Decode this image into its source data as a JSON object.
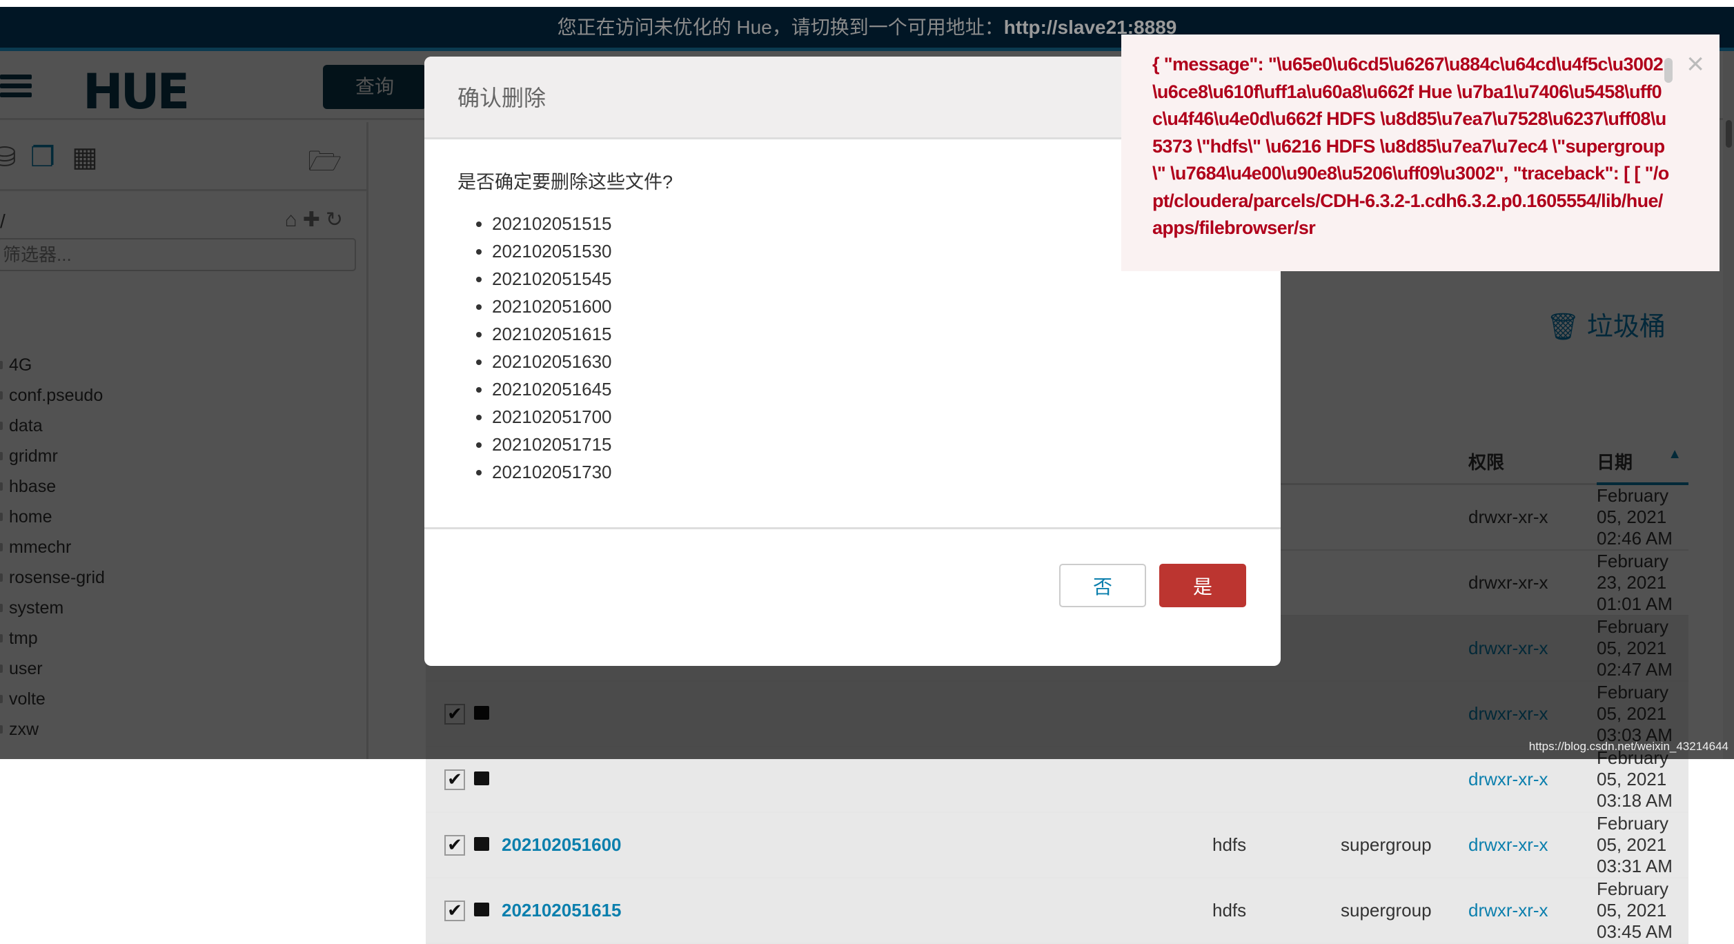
{
  "banner": {
    "text": "您正在访问未优化的 Hue，请切换到一个可用地址：",
    "address": "http://slave21:8889"
  },
  "header": {
    "logo": "HUE",
    "query_label": "查询"
  },
  "sidebar": {
    "path": "/",
    "filter_placeholder": "筛选器...",
    "items": [
      "4G",
      "conf.pseudo",
      "data",
      "gridmr",
      "hbase",
      "home",
      "mmechr",
      "rosense-grid",
      "system",
      "tmp",
      "user",
      "volte",
      "zxw"
    ]
  },
  "main": {
    "trash_label": "垃圾桶",
    "columns": {
      "user": "",
      "group": "",
      "perm": "权限",
      "date": "日期"
    },
    "rows": [
      {
        "checked": false,
        "name": "",
        "user": "",
        "group": "",
        "perm": "drwxr-xr-x",
        "date": "February 05, 2021 02:46 AM"
      },
      {
        "checked": false,
        "name": "",
        "user": "",
        "group": "",
        "perm": "drwxr-xr-x",
        "date": "February 23, 2021 01:01 AM"
      },
      {
        "checked": true,
        "name": "",
        "user": "",
        "group": "",
        "perm": "drwxr-xr-x",
        "date": "February 05, 2021 02:47 AM"
      },
      {
        "checked": true,
        "name": "",
        "user": "",
        "group": "",
        "perm": "drwxr-xr-x",
        "date": "February 05, 2021 03:03 AM"
      },
      {
        "checked": true,
        "name": "",
        "user": "",
        "group": "",
        "perm": "drwxr-xr-x",
        "date": "February 05, 2021 03:18 AM"
      },
      {
        "checked": true,
        "name": "202102051600",
        "user": "hdfs",
        "group": "supergroup",
        "perm": "drwxr-xr-x",
        "date": "February 05, 2021 03:31 AM"
      },
      {
        "checked": true,
        "name": "202102051615",
        "user": "hdfs",
        "group": "supergroup",
        "perm": "drwxr-xr-x",
        "date": "February 05, 2021 03:45 AM"
      }
    ]
  },
  "modal": {
    "title": "确认删除",
    "question": "是否确定要删除这些文件?",
    "files": [
      "202102051515",
      "202102051530",
      "202102051545",
      "202102051600",
      "202102051615",
      "202102051630",
      "202102051645",
      "202102051700",
      "202102051715",
      "202102051730"
    ],
    "no_label": "否",
    "yes_label": "是"
  },
  "toast": {
    "text": "{ \"message\": \"\\u65e0\\u6cd5\\u6267\\u884c\\u64cd\\u4f5c\\u3002 \\u6ce8\\u610f\\uff1a\\u60a8\\u662f Hue \\u7ba1\\u7406\\u5458\\uff0c\\u4f46\\u4e0d\\u662f HDFS \\u8d85\\u7ea7\\u7528\\u6237\\uff08\\u5373 \\\"hdfs\\\" \\u6216 HDFS \\u8d85\\u7ea7\\u7ec4 \\\"supergroup\\\" \\u7684\\u4e00\\u90e8\\u5206\\uff09\\u3002\", \"traceback\": [ [ \"/opt/cloudera/parcels/CDH-6.3.2-1.cdh6.3.2.p0.1605554/lib/hue/apps/filebrowser/sr",
    "close": "×"
  },
  "watermark": "https://blog.csdn.net/weixin_43214644",
  "colors": {
    "accent": "#0b7fad",
    "danger": "#bc3530",
    "brand": "#0b3a50",
    "error_text": "#b0001b"
  }
}
